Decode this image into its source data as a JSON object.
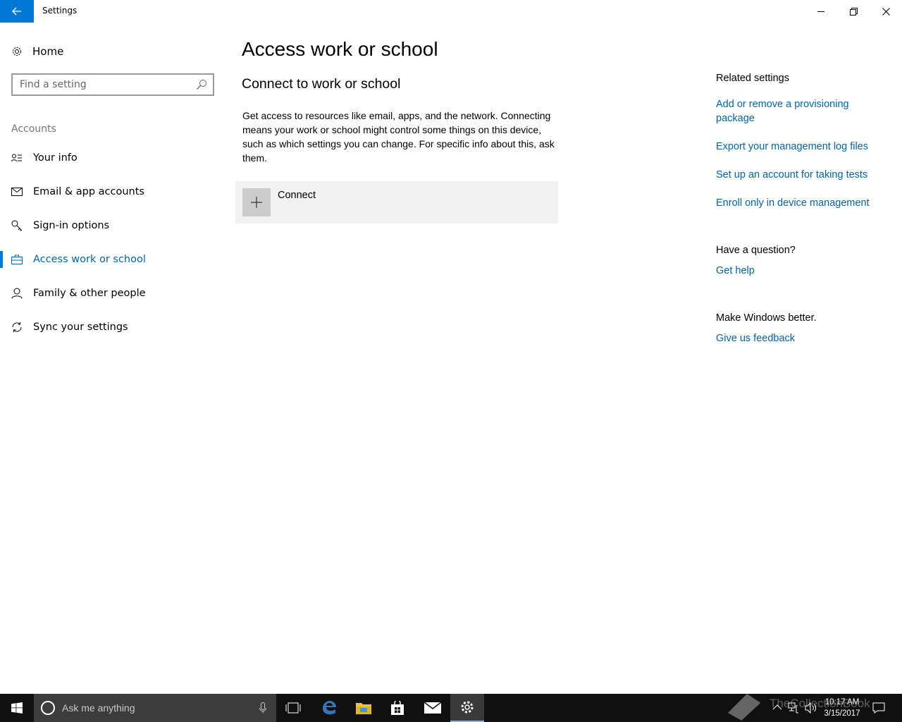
{
  "window": {
    "title": "Settings"
  },
  "sidebar": {
    "home_label": "Home",
    "search_placeholder": "Find a setting",
    "group_header": "Accounts",
    "items": [
      {
        "label": "Your info",
        "icon": "contact-card-icon"
      },
      {
        "label": "Email & app accounts",
        "icon": "mail-icon"
      },
      {
        "label": "Sign-in options",
        "icon": "key-icon"
      },
      {
        "label": "Access work or school",
        "icon": "briefcase-icon",
        "active": true
      },
      {
        "label": "Family & other people",
        "icon": "person-icon"
      },
      {
        "label": "Sync your settings",
        "icon": "sync-icon"
      }
    ]
  },
  "main": {
    "title": "Access work or school",
    "section_title": "Connect to work or school",
    "description": "Get access to resources like email, apps, and the network. Connecting means your work or school might control some things on this device, such as which settings you can change. For specific info about this, ask them.",
    "connect_label": "Connect"
  },
  "related": {
    "header": "Related settings",
    "links": [
      "Add or remove a provisioning package",
      "Export your management log files",
      "Set up an account for taking tests",
      "Enroll only in device management"
    ],
    "question_header": "Have a question?",
    "help_link": "Get help",
    "better_header": "Make Windows better.",
    "feedback_link": "Give us feedback"
  },
  "taskbar": {
    "search_placeholder": "Ask me anything",
    "time": "10:17 AM",
    "date": "3/15/2017",
    "watermark": "TheCollectionBook"
  },
  "colors": {
    "accent": "#0078d7",
    "link": "#0063b1",
    "taskbar": "#101010"
  }
}
